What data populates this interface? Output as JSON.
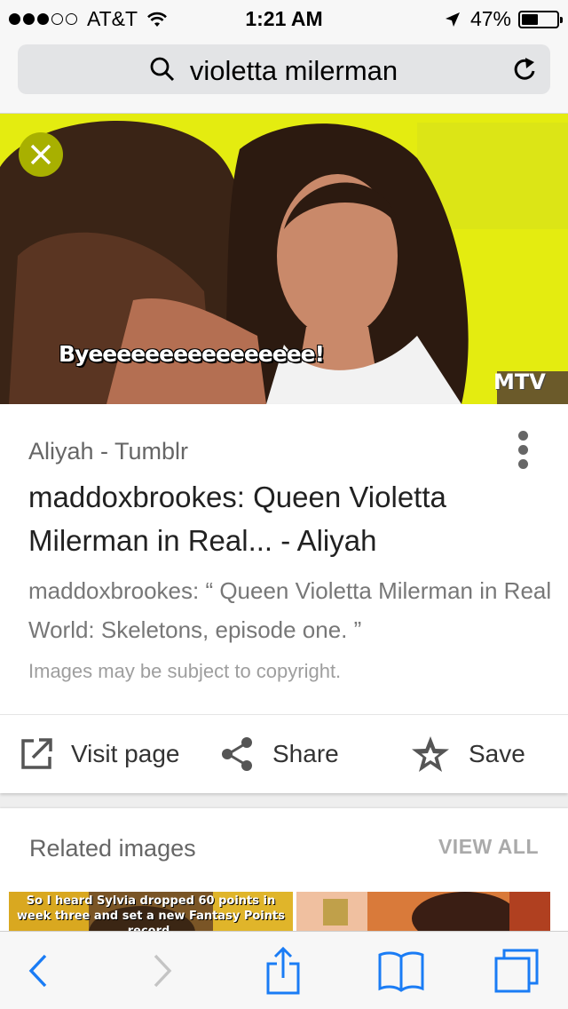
{
  "status_bar": {
    "carrier": "AT&T",
    "time": "1:21 AM",
    "battery": "47%",
    "battery_level": 0.47,
    "signal_bars": 3
  },
  "address_bar": {
    "query": "violetta milerman"
  },
  "hero": {
    "caption": "Byeeeeeeeeeeeeeeee!",
    "watermark": "MTV"
  },
  "result": {
    "source": "Aliyah - Tumblr",
    "title": "maddoxbrookes: Queen Violetta Milerman in Real... - Aliyah",
    "description": "maddoxbrookes: “ Queen Violetta Milerman in Real World: Skeletons, episode one. ”",
    "copyright": "Images may be subject to copyright."
  },
  "actions": {
    "visit": "Visit page",
    "share": "Share",
    "save": "Save"
  },
  "related": {
    "title": "Related images",
    "view_all": "VIEW ALL",
    "thumb1_caption": "So I heard Sylvia dropped 60 points in week three and set a new Fantasy Points record."
  },
  "colors": {
    "accent": "#1a7cf5",
    "hero_background": "#e4ec10"
  },
  "icons": [
    "search-icon",
    "reload-icon",
    "close-icon",
    "more-vert-icon",
    "open-in-new-icon",
    "share-icon",
    "star-icon",
    "back-icon",
    "forward-icon",
    "share-box-icon",
    "bookmarks-icon",
    "tabs-icon"
  ]
}
